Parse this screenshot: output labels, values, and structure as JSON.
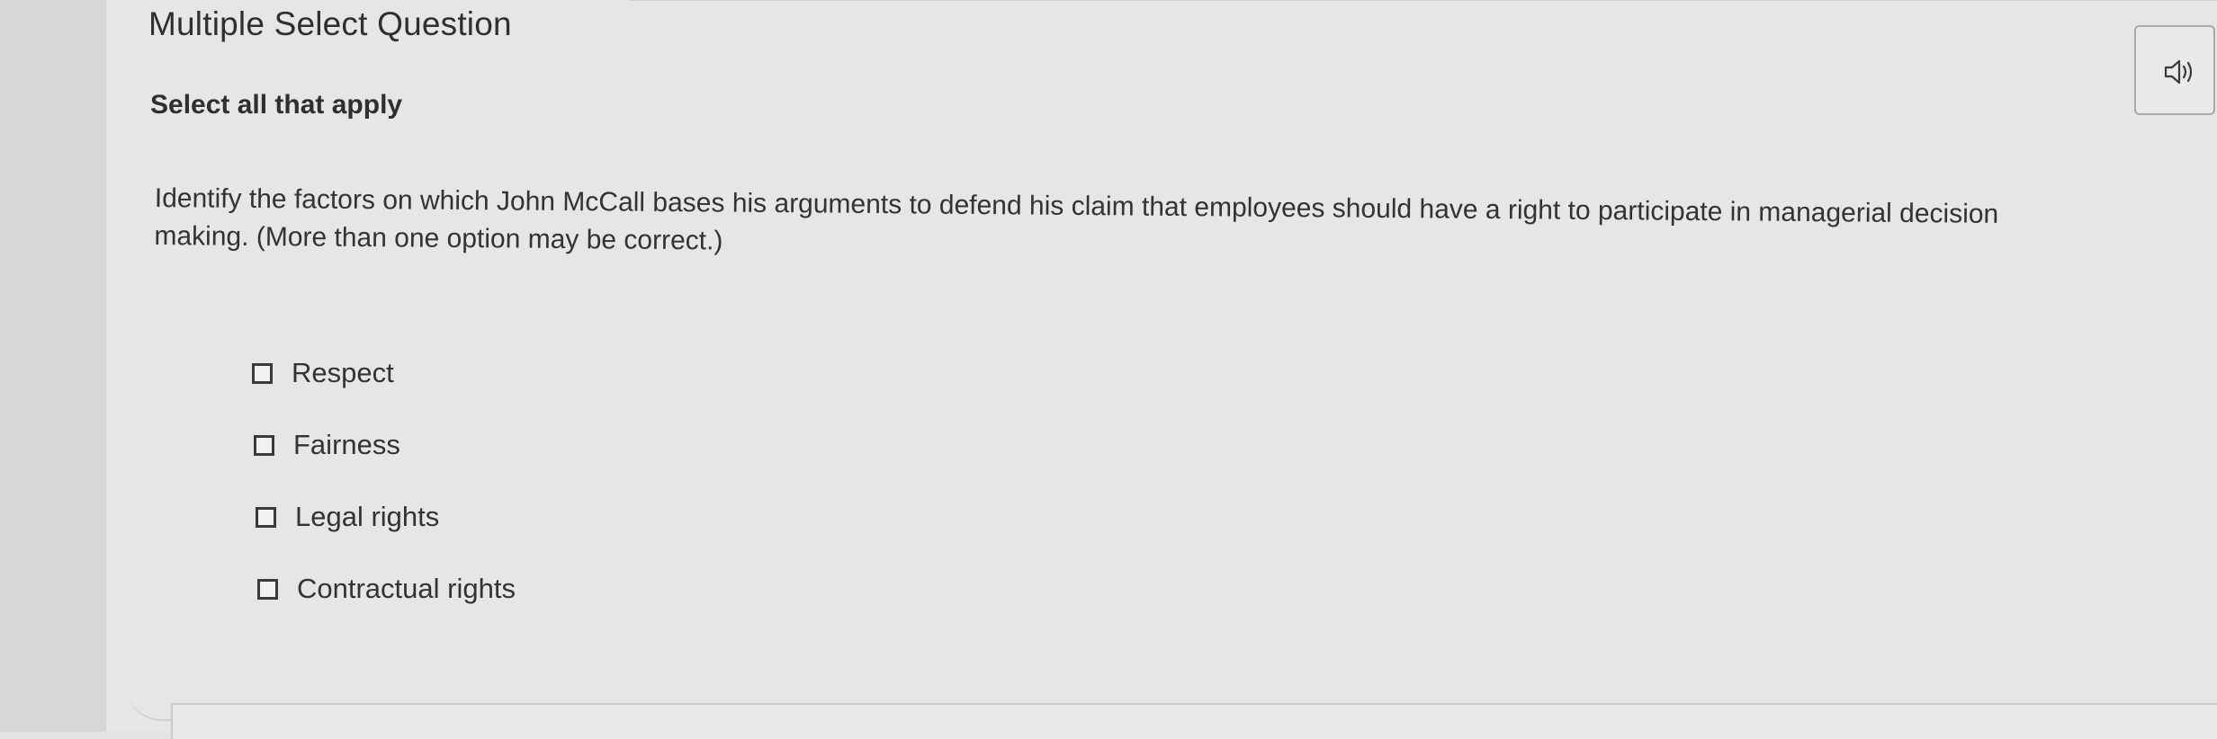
{
  "question": {
    "type_label": "Multiple Select Question",
    "instruction": "Select all that apply",
    "prompt_lines": [
      "Identify the factors on which John McCall bases his arguments to defend his claim that employees should have a right to participate in managerial decision",
      "making. (More than one option may be correct.)"
    ],
    "choices": [
      {
        "label": "Respect",
        "checked": false
      },
      {
        "label": "Fairness",
        "checked": false
      },
      {
        "label": "Legal rights",
        "checked": false
      },
      {
        "label": "Contractual rights",
        "checked": false
      }
    ]
  },
  "toolbar": {
    "audio_icon": "speaker-icon"
  }
}
